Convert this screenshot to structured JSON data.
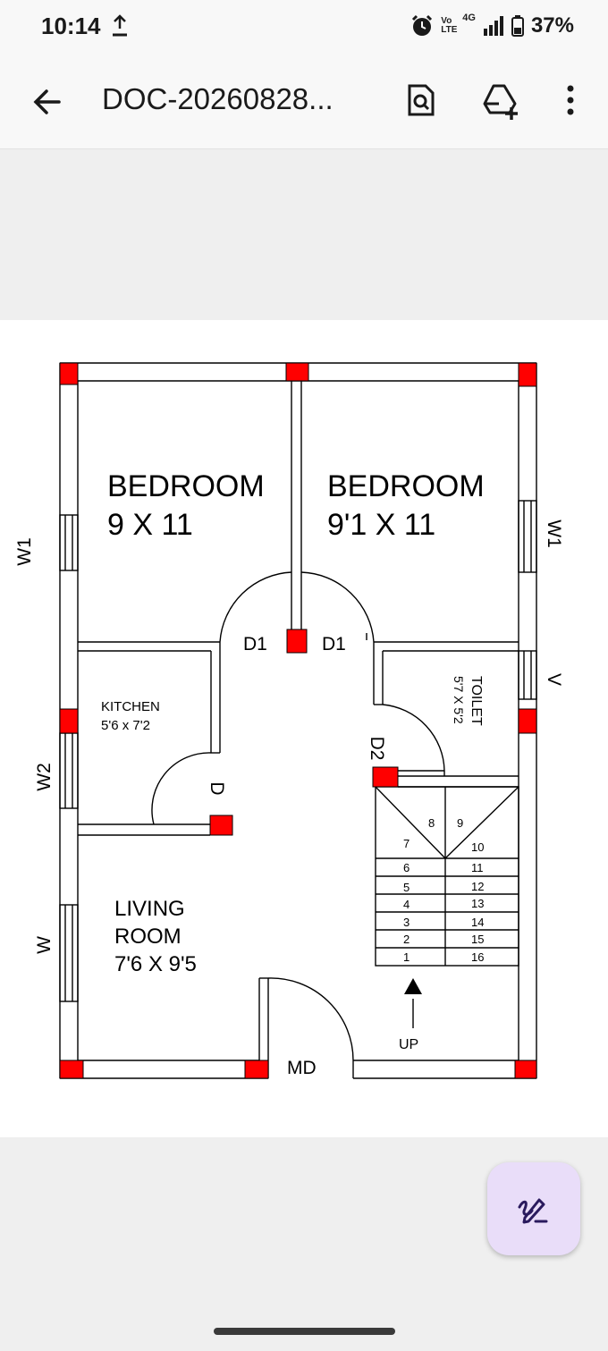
{
  "status_bar": {
    "time": "10:14",
    "network_volte": "Vo LTE",
    "network_type": "4G",
    "battery": "37%"
  },
  "app_bar": {
    "title": "DOC-20260828..."
  },
  "floor_plan": {
    "bedroom1": {
      "name": "BEDROOM",
      "size": "9 X 11"
    },
    "bedroom2": {
      "name": "BEDROOM",
      "size": "9'1 X 11"
    },
    "kitchen": {
      "name": "KITCHEN",
      "size": "5'6 x 7'2"
    },
    "toilet": {
      "name": "TOILET",
      "size": "5'7 X 5'2"
    },
    "living": {
      "name1": "LIVING",
      "name2": "ROOM",
      "size": "7'6 X 9'5"
    },
    "windows": {
      "w1_left": "W1",
      "w1_right": "W1",
      "w2": "W2",
      "w": "W",
      "v": "V"
    },
    "doors": {
      "d1_left": "D1",
      "d1_right": "D1",
      "d2": "D2",
      "d": "D",
      "main": "MD"
    },
    "stairs": {
      "left_steps": [
        "7",
        "6",
        "5",
        "4",
        "3",
        "2",
        "1"
      ],
      "right_steps": [
        "10",
        "11",
        "12",
        "13",
        "14",
        "15",
        "16"
      ],
      "landing_steps": [
        "8",
        "9"
      ],
      "direction": "UP"
    }
  },
  "colors": {
    "column": "#ff0000",
    "fab_bg": "#e9ddf9",
    "fab_icon": "#2a1a5e"
  }
}
